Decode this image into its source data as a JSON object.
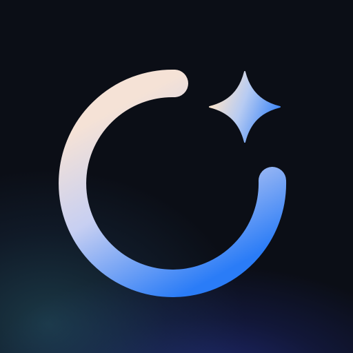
{
  "icon": {
    "background_color": "#0b0e16",
    "glow_colors": [
      "#285c6e",
      "#2834a0"
    ],
    "mark": "ring-with-sparkle",
    "ring_gradient": [
      "#f5e2d6",
      "#c7cff2",
      "#2a7cf7"
    ],
    "sparkle_gradient": [
      "#f9e3cc",
      "#b7cbf2",
      "#3d86f6"
    ]
  }
}
